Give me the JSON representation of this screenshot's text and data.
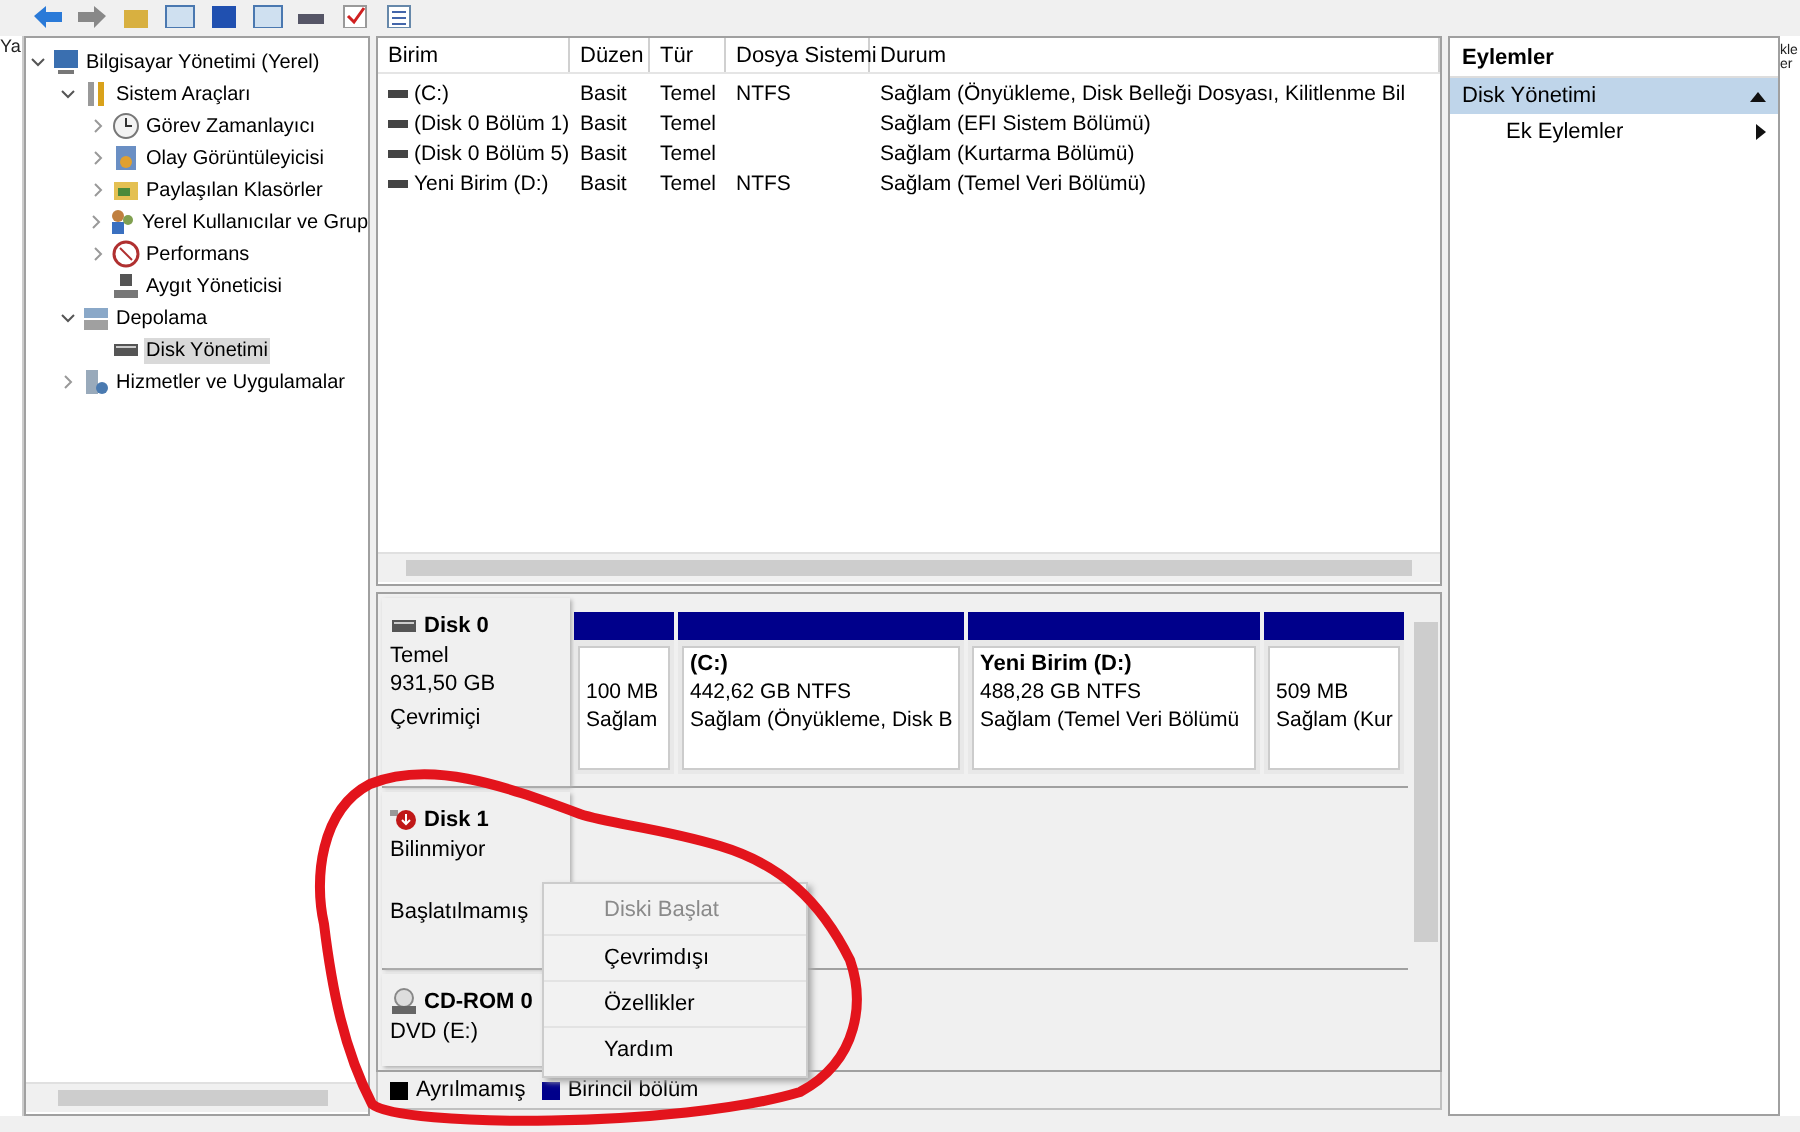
{
  "background_window": {
    "left_text": "Ya",
    "right_texts": [
      "kle",
      "er"
    ]
  },
  "tree": [
    {
      "label": "Bilgisayar Yönetimi (Yerel)",
      "kind": "computer",
      "expanded": true,
      "selected": false,
      "children": [
        {
          "label": "Sistem Araçları",
          "kind": "tools",
          "expanded": true,
          "selected": false,
          "children": [
            {
              "label": "Görev Zamanlayıcı",
              "kind": "clock",
              "expanded": false,
              "selected": false
            },
            {
              "label": "Olay Görüntüleyicisi",
              "kind": "event",
              "expanded": false,
              "selected": false
            },
            {
              "label": "Paylaşılan Klasörler",
              "kind": "folder",
              "expanded": false,
              "selected": false
            },
            {
              "label": "Yerel Kullanıcılar ve Grup",
              "kind": "users",
              "expanded": false,
              "selected": false
            },
            {
              "label": "Performans",
              "kind": "performance",
              "expanded": false,
              "selected": false
            },
            {
              "label": "Aygıt Yöneticisi",
              "kind": "device",
              "selected": false
            }
          ]
        },
        {
          "label": "Depolama",
          "kind": "storage",
          "expanded": true,
          "selected": false,
          "children": [
            {
              "label": "Disk Yönetimi",
              "kind": "disk",
              "selected": true
            }
          ]
        },
        {
          "label": "Hizmetler ve Uygulamalar",
          "kind": "services",
          "expanded": false,
          "selected": false
        }
      ]
    }
  ],
  "volume_table": {
    "columns": [
      "Birim",
      "Düzen",
      "Tür",
      "Dosya Sistemi",
      "Durum"
    ],
    "rows": [
      {
        "cells": [
          "(C:)",
          "Basit",
          "Temel",
          "NTFS",
          "Sağlam (Önyükleme, Disk Belleği Dosyası, Kilitlenme Bil"
        ]
      },
      {
        "cells": [
          "(Disk 0 Bölüm 1)",
          "Basit",
          "Temel",
          "",
          "Sağlam (EFI Sistem Bölümü)"
        ]
      },
      {
        "cells": [
          "(Disk 0 Bölüm 5)",
          "Basit",
          "Temel",
          "",
          "Sağlam (Kurtarma Bölümü)"
        ]
      },
      {
        "cells": [
          "Yeni Birim (D:)",
          "Basit",
          "Temel",
          "NTFS",
          "Sağlam (Temel Veri Bölümü)"
        ]
      }
    ]
  },
  "disks": [
    {
      "name": "Disk 0",
      "kind": "disk",
      "type": "Temel",
      "size": "931,50 GB",
      "status": "Çevrimiçi",
      "partitions": [
        {
          "lines": [
            "100 MB",
            "Sağlam"
          ]
        },
        {
          "title": "(C:)",
          "lines": [
            "442,62 GB NTFS",
            "Sağlam (Önyükleme, Disk B"
          ]
        },
        {
          "title": "Yeni Birim  (D:)",
          "lines": [
            "488,28 GB NTFS",
            "Sağlam (Temel Veri Bölümü"
          ]
        },
        {
          "lines": [
            "509 MB",
            "Sağlam (Kur"
          ]
        }
      ]
    },
    {
      "name": "Disk 1",
      "kind": "unknown",
      "type": "Bilinmiyor",
      "status": "Başlatılmamış"
    },
    {
      "name": "CD-ROM 0",
      "kind": "cdrom",
      "type": "DVD (E:)"
    }
  ],
  "context_menu": {
    "items": [
      {
        "label": "Diski Başlat",
        "disabled": true
      },
      {
        "label": "Çevrimdışı",
        "disabled": false
      },
      {
        "label": "Özellikler",
        "disabled": false
      },
      {
        "label": "Yardım",
        "disabled": false
      }
    ]
  },
  "legend": [
    {
      "label": "Ayrılmamış",
      "color": "#000000"
    },
    {
      "label": "Birincil bölüm",
      "color": "#00008b"
    }
  ],
  "actions": {
    "title": "Eylemler",
    "groups": [
      {
        "label": "Disk Yönetimi",
        "expanded": true,
        "items": [
          "Ek Eylemler"
        ]
      }
    ]
  }
}
